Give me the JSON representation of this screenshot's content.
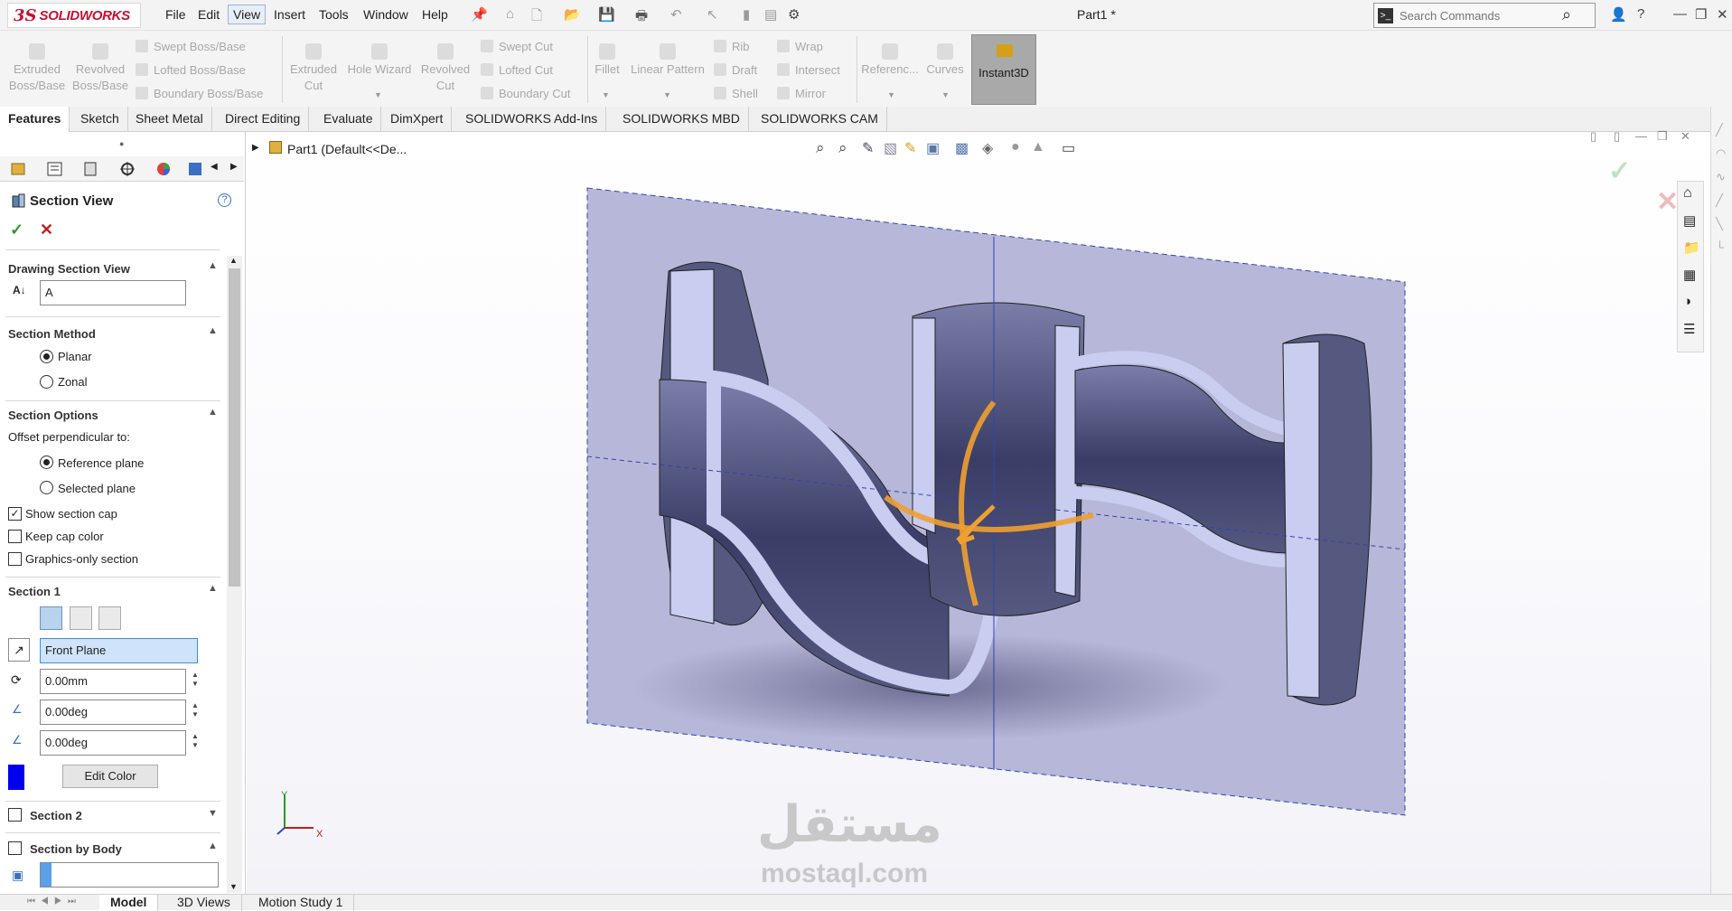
{
  "app": {
    "logo_ds": "3S",
    "logo_text": "SOLIDWORKS",
    "document_title": "Part1 *"
  },
  "menu": [
    "File",
    "Edit",
    "View",
    "Insert",
    "Tools",
    "Window",
    "Help"
  ],
  "search": {
    "placeholder": "Search Commands"
  },
  "ribbon": {
    "extruded_boss": "Extruded\nBoss/Base",
    "revolved_boss": "Revolved\nBoss/Base",
    "swept_boss": "Swept Boss/Base",
    "lofted_boss": "Lofted Boss/Base",
    "boundary_boss": "Boundary Boss/Base",
    "extruded_cut": "Extruded\nCut",
    "hole_wizard": "Hole Wizard",
    "revolved_cut": "Revolved\nCut",
    "swept_cut": "Swept Cut",
    "lofted_cut": "Lofted Cut",
    "boundary_cut": "Boundary Cut",
    "fillet": "Fillet",
    "linear_pattern": "Linear Pattern",
    "rib": "Rib",
    "draft": "Draft",
    "shell": "Shell",
    "wrap": "Wrap",
    "intersect": "Intersect",
    "mirror": "Mirror",
    "reference": "Referenc...",
    "curves": "Curves",
    "instant3d": "Instant3D"
  },
  "tabs": [
    "Features",
    "Sketch",
    "Sheet Metal",
    "Direct Editing",
    "Evaluate",
    "DimXpert",
    "SOLIDWORKS Add-Ins",
    "SOLIDWORKS MBD",
    "SOLIDWORKS CAM"
  ],
  "tree_root": {
    "label": "Part1  (Default<<De..."
  },
  "property_manager": {
    "title": "Section View",
    "drawing_section_view": {
      "heading": "Drawing Section View",
      "name_value": "A"
    },
    "section_method": {
      "heading": "Section Method",
      "options": [
        "Planar",
        "Zonal"
      ],
      "selected": "Planar"
    },
    "section_options": {
      "heading": "Section Options",
      "offset_label": "Offset perpendicular to:",
      "options": [
        "Reference plane",
        "Selected plane"
      ],
      "selected": "Reference plane",
      "show_section_cap": "Show section cap",
      "keep_cap_color": "Keep cap color",
      "graphics_only": "Graphics-only section"
    },
    "section1": {
      "heading": "Section 1",
      "plane": "Front Plane",
      "offset": "0.00mm",
      "angle_x": "0.00deg",
      "angle_y": "0.00deg",
      "edit_color": "Edit Color",
      "cap_color": "#0000ee"
    },
    "section2": {
      "heading": "Section 2"
    },
    "section_by_body": {
      "heading": "Section by Body"
    }
  },
  "bottom_tabs": [
    "Model",
    "3D Views",
    "Motion Study 1"
  ],
  "triad": {
    "x": "X",
    "y": "Y"
  },
  "watermark": {
    "arabic": "مستقل",
    "latin": "mostaql.com"
  },
  "colors": {
    "accent_red": "#c8102e",
    "section_plane": "#b6b6d8",
    "manipulator": "#f0a030",
    "section_cap": "#c9cdf0"
  }
}
